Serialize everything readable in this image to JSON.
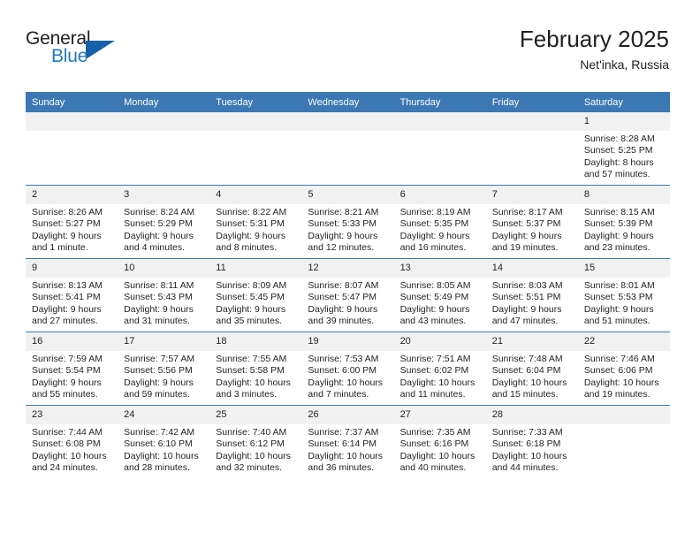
{
  "brand": {
    "name_part1": "General",
    "name_part2": "Blue",
    "logo_icon": "triangle-logo-icon"
  },
  "header": {
    "title": "February 2025",
    "location": "Net'inka, Russia"
  },
  "colors": {
    "header_blue": "#3c78b4",
    "brand_blue": "#1f7bc1",
    "logo_blue": "#1560a8",
    "daynum_band": "#f1f1f1",
    "text": "#231f20"
  },
  "weekday_headers": [
    "Sunday",
    "Monday",
    "Tuesday",
    "Wednesday",
    "Thursday",
    "Friday",
    "Saturday"
  ],
  "weeks": [
    [
      {
        "empty": true
      },
      {
        "empty": true
      },
      {
        "empty": true
      },
      {
        "empty": true
      },
      {
        "empty": true
      },
      {
        "empty": true
      },
      {
        "day": "1",
        "sunrise": "Sunrise: 8:28 AM",
        "sunset": "Sunset: 5:25 PM",
        "daylight": "Daylight: 8 hours and 57 minutes."
      }
    ],
    [
      {
        "day": "2",
        "sunrise": "Sunrise: 8:26 AM",
        "sunset": "Sunset: 5:27 PM",
        "daylight": "Daylight: 9 hours and 1 minute."
      },
      {
        "day": "3",
        "sunrise": "Sunrise: 8:24 AM",
        "sunset": "Sunset: 5:29 PM",
        "daylight": "Daylight: 9 hours and 4 minutes."
      },
      {
        "day": "4",
        "sunrise": "Sunrise: 8:22 AM",
        "sunset": "Sunset: 5:31 PM",
        "daylight": "Daylight: 9 hours and 8 minutes."
      },
      {
        "day": "5",
        "sunrise": "Sunrise: 8:21 AM",
        "sunset": "Sunset: 5:33 PM",
        "daylight": "Daylight: 9 hours and 12 minutes."
      },
      {
        "day": "6",
        "sunrise": "Sunrise: 8:19 AM",
        "sunset": "Sunset: 5:35 PM",
        "daylight": "Daylight: 9 hours and 16 minutes."
      },
      {
        "day": "7",
        "sunrise": "Sunrise: 8:17 AM",
        "sunset": "Sunset: 5:37 PM",
        "daylight": "Daylight: 9 hours and 19 minutes."
      },
      {
        "day": "8",
        "sunrise": "Sunrise: 8:15 AM",
        "sunset": "Sunset: 5:39 PM",
        "daylight": "Daylight: 9 hours and 23 minutes."
      }
    ],
    [
      {
        "day": "9",
        "sunrise": "Sunrise: 8:13 AM",
        "sunset": "Sunset: 5:41 PM",
        "daylight": "Daylight: 9 hours and 27 minutes."
      },
      {
        "day": "10",
        "sunrise": "Sunrise: 8:11 AM",
        "sunset": "Sunset: 5:43 PM",
        "daylight": "Daylight: 9 hours and 31 minutes."
      },
      {
        "day": "11",
        "sunrise": "Sunrise: 8:09 AM",
        "sunset": "Sunset: 5:45 PM",
        "daylight": "Daylight: 9 hours and 35 minutes."
      },
      {
        "day": "12",
        "sunrise": "Sunrise: 8:07 AM",
        "sunset": "Sunset: 5:47 PM",
        "daylight": "Daylight: 9 hours and 39 minutes."
      },
      {
        "day": "13",
        "sunrise": "Sunrise: 8:05 AM",
        "sunset": "Sunset: 5:49 PM",
        "daylight": "Daylight: 9 hours and 43 minutes."
      },
      {
        "day": "14",
        "sunrise": "Sunrise: 8:03 AM",
        "sunset": "Sunset: 5:51 PM",
        "daylight": "Daylight: 9 hours and 47 minutes."
      },
      {
        "day": "15",
        "sunrise": "Sunrise: 8:01 AM",
        "sunset": "Sunset: 5:53 PM",
        "daylight": "Daylight: 9 hours and 51 minutes."
      }
    ],
    [
      {
        "day": "16",
        "sunrise": "Sunrise: 7:59 AM",
        "sunset": "Sunset: 5:54 PM",
        "daylight": "Daylight: 9 hours and 55 minutes."
      },
      {
        "day": "17",
        "sunrise": "Sunrise: 7:57 AM",
        "sunset": "Sunset: 5:56 PM",
        "daylight": "Daylight: 9 hours and 59 minutes."
      },
      {
        "day": "18",
        "sunrise": "Sunrise: 7:55 AM",
        "sunset": "Sunset: 5:58 PM",
        "daylight": "Daylight: 10 hours and 3 minutes."
      },
      {
        "day": "19",
        "sunrise": "Sunrise: 7:53 AM",
        "sunset": "Sunset: 6:00 PM",
        "daylight": "Daylight: 10 hours and 7 minutes."
      },
      {
        "day": "20",
        "sunrise": "Sunrise: 7:51 AM",
        "sunset": "Sunset: 6:02 PM",
        "daylight": "Daylight: 10 hours and 11 minutes."
      },
      {
        "day": "21",
        "sunrise": "Sunrise: 7:48 AM",
        "sunset": "Sunset: 6:04 PM",
        "daylight": "Daylight: 10 hours and 15 minutes."
      },
      {
        "day": "22",
        "sunrise": "Sunrise: 7:46 AM",
        "sunset": "Sunset: 6:06 PM",
        "daylight": "Daylight: 10 hours and 19 minutes."
      }
    ],
    [
      {
        "day": "23",
        "sunrise": "Sunrise: 7:44 AM",
        "sunset": "Sunset: 6:08 PM",
        "daylight": "Daylight: 10 hours and 24 minutes."
      },
      {
        "day": "24",
        "sunrise": "Sunrise: 7:42 AM",
        "sunset": "Sunset: 6:10 PM",
        "daylight": "Daylight: 10 hours and 28 minutes."
      },
      {
        "day": "25",
        "sunrise": "Sunrise: 7:40 AM",
        "sunset": "Sunset: 6:12 PM",
        "daylight": "Daylight: 10 hours and 32 minutes."
      },
      {
        "day": "26",
        "sunrise": "Sunrise: 7:37 AM",
        "sunset": "Sunset: 6:14 PM",
        "daylight": "Daylight: 10 hours and 36 minutes."
      },
      {
        "day": "27",
        "sunrise": "Sunrise: 7:35 AM",
        "sunset": "Sunset: 6:16 PM",
        "daylight": "Daylight: 10 hours and 40 minutes."
      },
      {
        "day": "28",
        "sunrise": "Sunrise: 7:33 AM",
        "sunset": "Sunset: 6:18 PM",
        "daylight": "Daylight: 10 hours and 44 minutes."
      },
      {
        "empty": true
      }
    ]
  ]
}
